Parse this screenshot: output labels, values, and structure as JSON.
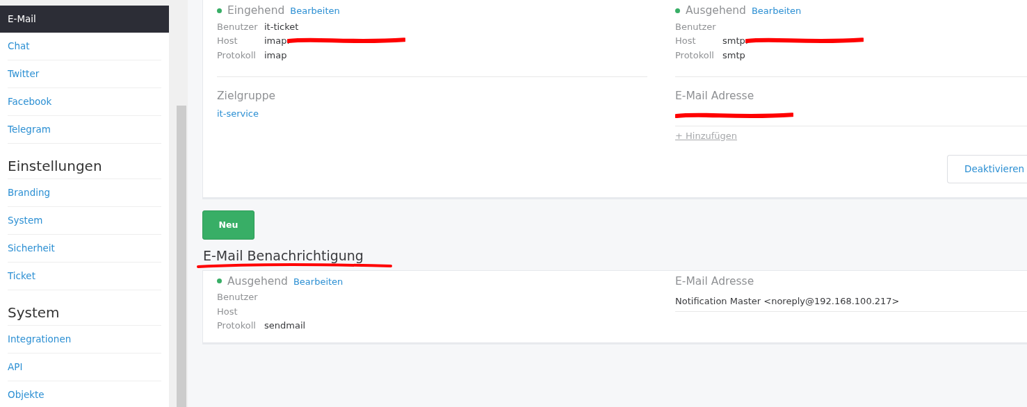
{
  "sidebar": {
    "groups": [
      {
        "items": [
          {
            "label": "E-Mail",
            "selected": true
          },
          {
            "label": "Chat",
            "selected": false
          },
          {
            "label": "Twitter",
            "selected": false
          },
          {
            "label": "Facebook",
            "selected": false
          },
          {
            "label": "Telegram",
            "selected": false
          }
        ]
      },
      {
        "title": "Einstellungen",
        "items": [
          {
            "label": "Branding",
            "selected": false
          },
          {
            "label": "System",
            "selected": false
          },
          {
            "label": "Sicherheit",
            "selected": false
          },
          {
            "label": "Ticket",
            "selected": false
          }
        ]
      },
      {
        "title": "System",
        "items": [
          {
            "label": "Integrationen",
            "selected": false
          },
          {
            "label": "API",
            "selected": false
          },
          {
            "label": "Objekte",
            "selected": false
          }
        ]
      }
    ]
  },
  "accounts": {
    "channels": [
      {
        "left": {
          "title": "Eingehend",
          "active": true,
          "edit_link": "Bearbeiten",
          "fields": [
            {
              "label": "Benutzer",
              "value": "it-ticket"
            },
            {
              "label": "Host",
              "value": "imap.",
              "redacted": true
            },
            {
              "label": "Protokoll",
              "value": "imap"
            }
          ]
        },
        "right": {
          "title": "Ausgehend",
          "active": true,
          "edit_link": "Bearbeiten",
          "fields": [
            {
              "label": "Benutzer"
            },
            {
              "label": "Host",
              "value": "smtp.",
              "redacted": true
            },
            {
              "label": "Protokoll",
              "value": "smtp"
            }
          ]
        },
        "group": {
          "title": "Zielgruppe",
          "value": "it-service"
        },
        "addresses": {
          "title": "E-Mail Adresse",
          "items": [
            {
              "redacted": true
            }
          ],
          "add_link": "+ Hinzufügen"
        },
        "button": "Deaktivieren"
      }
    ],
    "new_button": "Neu"
  },
  "notification": {
    "heading": "E-Mail Benachrichtigung",
    "underlined": true,
    "left": {
      "title": "Ausgehend",
      "active": true,
      "edit_link": "Bearbeiten",
      "fields": [
        {
          "label": "Benutzer"
        },
        {
          "label": "Host"
        },
        {
          "label": "Protokoll",
          "value": "sendmail"
        }
      ]
    },
    "addresses": {
      "title": "E-Mail Adresse",
      "items": [
        {
          "value": "Notification Master <noreply@192.168.100.217>"
        }
      ]
    }
  }
}
